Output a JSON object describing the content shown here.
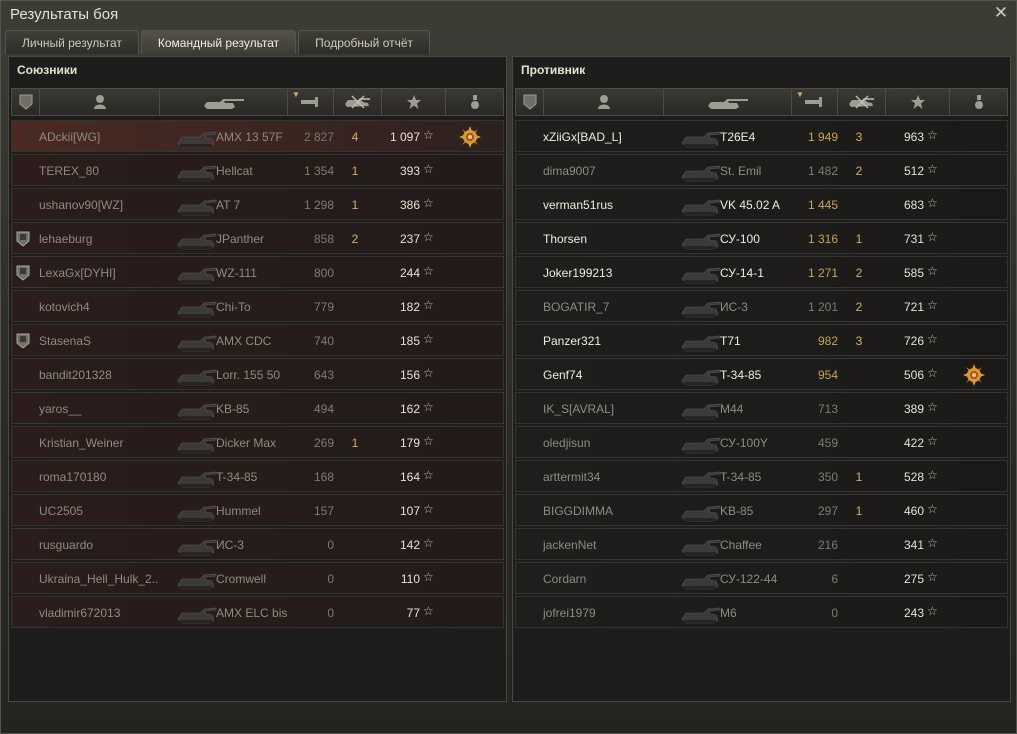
{
  "window": {
    "title": "Результаты боя"
  },
  "tabs": [
    {
      "label": "Личный результат",
      "active": false
    },
    {
      "label": "Командный результат",
      "active": true
    },
    {
      "label": "Подробный отчёт",
      "active": false
    }
  ],
  "teams": {
    "allies": {
      "title": "Союзники",
      "players": [
        {
          "name": "ADckii[WG]",
          "tank": "AMX 13 57F",
          "damage": "2 827",
          "frags": "4",
          "xp": "1 097",
          "squad": false,
          "alive": false,
          "me": true,
          "medal": true
        },
        {
          "name": "TEREX_80",
          "tank": "Hellcat",
          "damage": "1 354",
          "frags": "1",
          "xp": "393",
          "squad": false,
          "alive": false,
          "me": false,
          "medal": false
        },
        {
          "name": "ushanov90[WZ]",
          "tank": "AT 7",
          "damage": "1 298",
          "frags": "1",
          "xp": "386",
          "squad": false,
          "alive": false,
          "me": false,
          "medal": false
        },
        {
          "name": "lehaeburg",
          "tank": "JPanther",
          "damage": "858",
          "frags": "2",
          "xp": "237",
          "squad": true,
          "alive": false,
          "me": false,
          "medal": false
        },
        {
          "name": "LexaGx[DYHI]",
          "tank": "WZ-111",
          "damage": "800",
          "frags": "",
          "xp": "244",
          "squad": true,
          "alive": false,
          "me": false,
          "medal": false
        },
        {
          "name": "kotovich4",
          "tank": "Chi-To",
          "damage": "779",
          "frags": "",
          "xp": "182",
          "squad": false,
          "alive": false,
          "me": false,
          "medal": false
        },
        {
          "name": "StasenaS",
          "tank": "AMX CDC",
          "damage": "740",
          "frags": "",
          "xp": "185",
          "squad": true,
          "alive": false,
          "me": false,
          "medal": false
        },
        {
          "name": "bandit201328",
          "tank": "Lorr. 155 50",
          "damage": "643",
          "frags": "",
          "xp": "156",
          "squad": false,
          "alive": false,
          "me": false,
          "medal": false
        },
        {
          "name": "yaros__",
          "tank": "KB-85",
          "damage": "494",
          "frags": "",
          "xp": "162",
          "squad": false,
          "alive": false,
          "me": false,
          "medal": false
        },
        {
          "name": "Kristian_Weiner",
          "tank": "Dicker Max",
          "damage": "269",
          "frags": "1",
          "xp": "179",
          "squad": false,
          "alive": false,
          "me": false,
          "medal": false
        },
        {
          "name": "roma170180",
          "tank": "T-34-85",
          "damage": "168",
          "frags": "",
          "xp": "164",
          "squad": false,
          "alive": false,
          "me": false,
          "medal": false
        },
        {
          "name": "UC2505",
          "tank": "Hummel",
          "damage": "157",
          "frags": "",
          "xp": "107",
          "squad": false,
          "alive": false,
          "me": false,
          "medal": false
        },
        {
          "name": "rusguardo",
          "tank": "ИС-3",
          "damage": "0",
          "frags": "",
          "xp": "142",
          "squad": false,
          "alive": false,
          "me": false,
          "medal": false
        },
        {
          "name": "Ukraina_Hell_Hulk_2..",
          "tank": "Cromwell",
          "damage": "0",
          "frags": "",
          "xp": "110",
          "squad": false,
          "alive": false,
          "me": false,
          "medal": false
        },
        {
          "name": "vladimir672013",
          "tank": "AMX ELC bis",
          "damage": "0",
          "frags": "",
          "xp": "77",
          "squad": false,
          "alive": false,
          "me": false,
          "medal": false
        }
      ]
    },
    "enemies": {
      "title": "Противник",
      "players": [
        {
          "name": "xZiiGx[BAD_L]",
          "tank": "T26E4",
          "damage": "1 949",
          "frags": "3",
          "xp": "963",
          "squad": false,
          "alive": true,
          "me": false,
          "medal": false
        },
        {
          "name": "dima9007",
          "tank": "St. Emil",
          "damage": "1 482",
          "frags": "2",
          "xp": "512",
          "squad": false,
          "alive": false,
          "me": false,
          "medal": false
        },
        {
          "name": "verman51rus",
          "tank": "VK 45.02 A",
          "damage": "1 445",
          "frags": "",
          "xp": "683",
          "squad": false,
          "alive": true,
          "me": false,
          "medal": false
        },
        {
          "name": "Thorsen",
          "tank": "СУ-100",
          "damage": "1 316",
          "frags": "1",
          "xp": "731",
          "squad": false,
          "alive": true,
          "me": false,
          "medal": false
        },
        {
          "name": "Joker199213",
          "tank": "СУ-14-1",
          "damage": "1 271",
          "frags": "2",
          "xp": "585",
          "squad": false,
          "alive": true,
          "me": false,
          "medal": false
        },
        {
          "name": "BOGATIR_7",
          "tank": "ИС-3",
          "damage": "1 201",
          "frags": "2",
          "xp": "721",
          "squad": false,
          "alive": false,
          "me": false,
          "medal": false
        },
        {
          "name": "Panzer321",
          "tank": "T71",
          "damage": "982",
          "frags": "3",
          "xp": "726",
          "squad": false,
          "alive": true,
          "me": false,
          "medal": false
        },
        {
          "name": "Genf74",
          "tank": "T-34-85",
          "damage": "954",
          "frags": "",
          "xp": "506",
          "squad": false,
          "alive": true,
          "me": false,
          "medal": true
        },
        {
          "name": "IK_S[AVRAL]",
          "tank": "M44",
          "damage": "713",
          "frags": "",
          "xp": "389",
          "squad": false,
          "alive": false,
          "me": false,
          "medal": false
        },
        {
          "name": "oledjisun",
          "tank": "СУ-100Y",
          "damage": "459",
          "frags": "",
          "xp": "422",
          "squad": false,
          "alive": false,
          "me": false,
          "medal": false
        },
        {
          "name": "arttermit34",
          "tank": "T-34-85",
          "damage": "350",
          "frags": "1",
          "xp": "528",
          "squad": false,
          "alive": false,
          "me": false,
          "medal": false
        },
        {
          "name": "BIGGDIMMA",
          "tank": "KB-85",
          "damage": "297",
          "frags": "1",
          "xp": "460",
          "squad": false,
          "alive": false,
          "me": false,
          "medal": false
        },
        {
          "name": "jackenNet",
          "tank": "Chaffee",
          "damage": "216",
          "frags": "",
          "xp": "341",
          "squad": false,
          "alive": false,
          "me": false,
          "medal": false
        },
        {
          "name": "Cordarn",
          "tank": "СУ-122-44",
          "damage": "6",
          "frags": "",
          "xp": "275",
          "squad": false,
          "alive": false,
          "me": false,
          "medal": false
        },
        {
          "name": "jofrei1979",
          "tank": "M6",
          "damage": "0",
          "frags": "",
          "xp": "243",
          "squad": false,
          "alive": false,
          "me": false,
          "medal": false
        }
      ]
    }
  },
  "icons": {
    "close": "close-icon",
    "squad": "squad-icon",
    "player": "player-icon",
    "tank": "tank-icon",
    "damage": "damage-icon",
    "frags": "frags-icon",
    "xp": "star-icon",
    "medal": "medal-icon"
  },
  "colors": {
    "accent_gold": "#d4b06b",
    "ally_row": "#2a1d1b",
    "enemy_row": "#1f1e1c"
  }
}
